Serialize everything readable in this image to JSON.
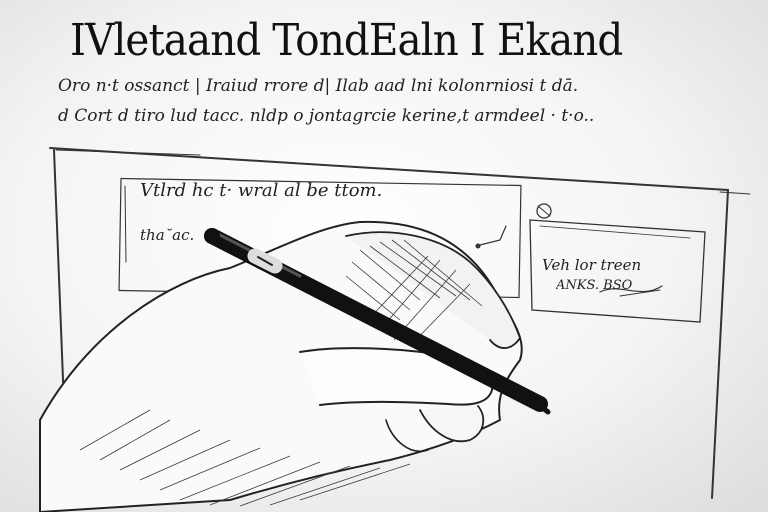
{
  "heading": "IVletaand TondEaln I Ekand",
  "line1": "Oro n·t ossanct | Iraiud rrore d| Ilab aad lni kolonrniosi t dā.",
  "line2": "d Cort d tiro lud tacc. nldp o jontagrcie kerine,t armdeel · t·o..",
  "panel_text1": "Vtlrd hc t· wral al be ttom.",
  "panel_text2": "tha˘ac.",
  "side_text1": "Veh lor treen",
  "side_text2": "ANKS. BSO"
}
